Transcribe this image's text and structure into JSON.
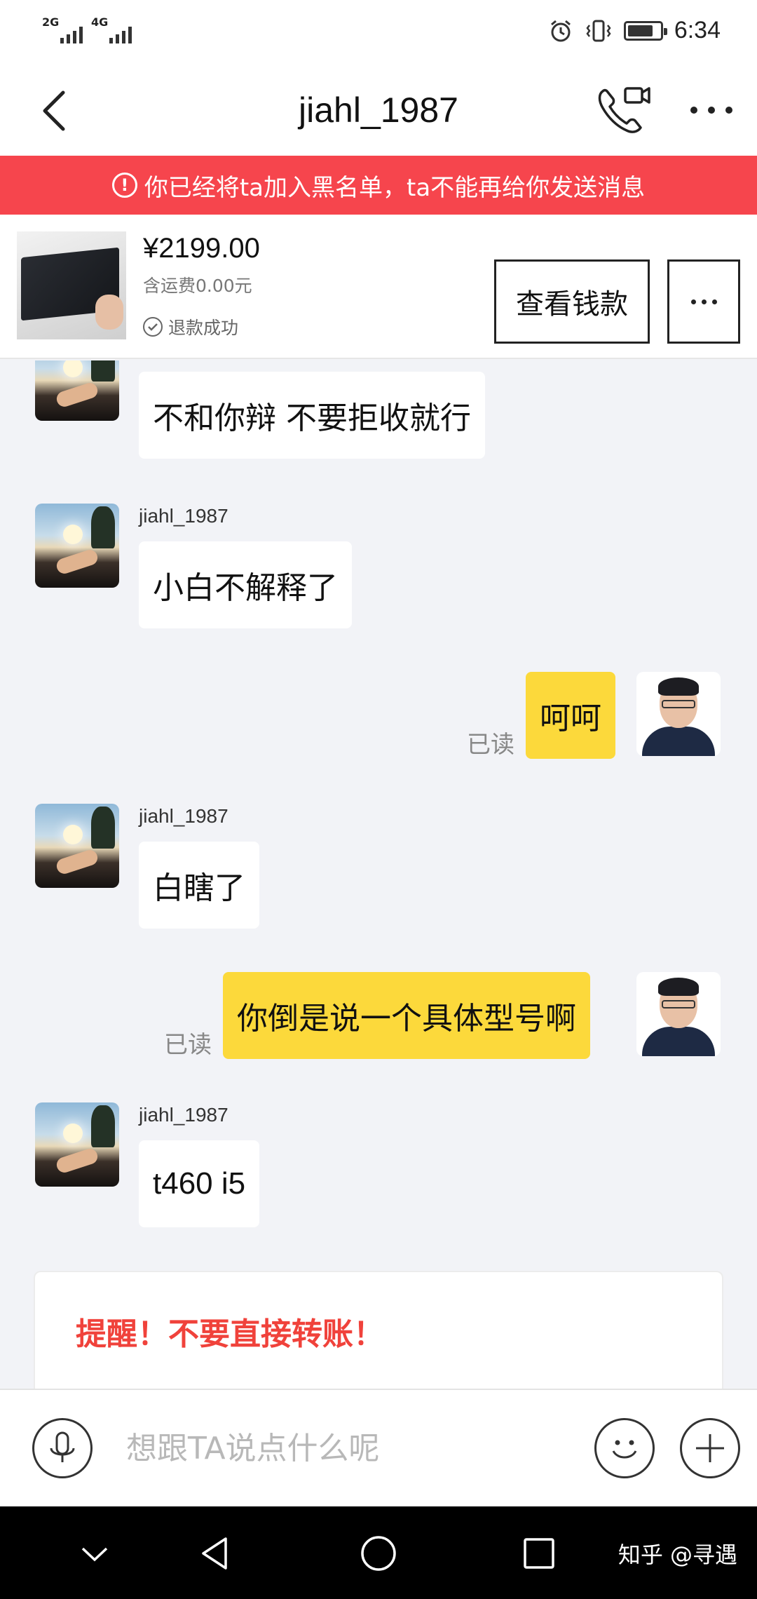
{
  "status_bar": {
    "network_1": "2G",
    "network_2": "4G",
    "time": "6:34",
    "battery_level": 0.8
  },
  "header": {
    "title": "jiahl_1987"
  },
  "warning": {
    "icon": "alert-circle-icon",
    "text": "你已经将ta加入黑名单，ta不能再给你发送消息"
  },
  "product": {
    "price": "¥2199.00",
    "shipping": "含运费0.00元",
    "refund_status": "退款成功",
    "view_money_label": "查看钱款"
  },
  "messages": [
    {
      "from": "other",
      "sender": "",
      "text": "不和你辩 不要拒收就行"
    },
    {
      "from": "other",
      "sender": "jiahl_1987",
      "text": "小白不解释了"
    },
    {
      "from": "self",
      "text": "呵呵",
      "read": "已读"
    },
    {
      "from": "other",
      "sender": "jiahl_1987",
      "text": "白瞎了"
    },
    {
      "from": "self",
      "text": "你倒是说一个具体型号啊",
      "read": "已读"
    },
    {
      "from": "other",
      "sender": "jiahl_1987",
      "text": "t460 i5"
    }
  ],
  "reminder": {
    "title": "提醒！不要直接转账！"
  },
  "input": {
    "placeholder": "想跟TA说点什么呢"
  },
  "navbar": {
    "watermark": "知乎 @寻遇"
  },
  "colors": {
    "warning_bg": "#f6454d",
    "outgoing_bubble": "#fcd93b",
    "reminder_title": "#f0423b"
  }
}
